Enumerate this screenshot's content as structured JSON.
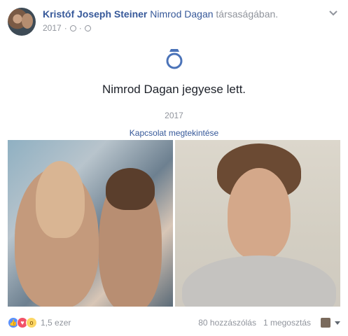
{
  "post": {
    "author": "Kristóf Joseph Steiner",
    "tagged": "Nimrod Dagan",
    "tag_suffix": "társaságában.",
    "year": "2017",
    "meta_separator": "·",
    "clock_icon": "clock-icon",
    "privacy_icon": "globe-icon",
    "options_icon": "chevron-down-icon"
  },
  "event": {
    "icon": "ring-icon",
    "title": "Nimrod Dagan jegyese lett.",
    "year": "2017",
    "link_text": "Kapcsolat megtekintése"
  },
  "photos": [
    {
      "name": "photo-couple",
      "icon": "image"
    },
    {
      "name": "photo-portrait",
      "icon": "image"
    }
  ],
  "footer": {
    "reaction_icons": [
      "like-icon",
      "love-icon",
      "wow-icon"
    ],
    "reaction_count": "1,5 ezer",
    "comments": "80 hozzászólás",
    "shares": "1 megosztás"
  },
  "colors": {
    "link": "#365899",
    "muted": "#90949c",
    "like": "#5890ff",
    "love": "#f25268",
    "wow": "#fcd664"
  }
}
